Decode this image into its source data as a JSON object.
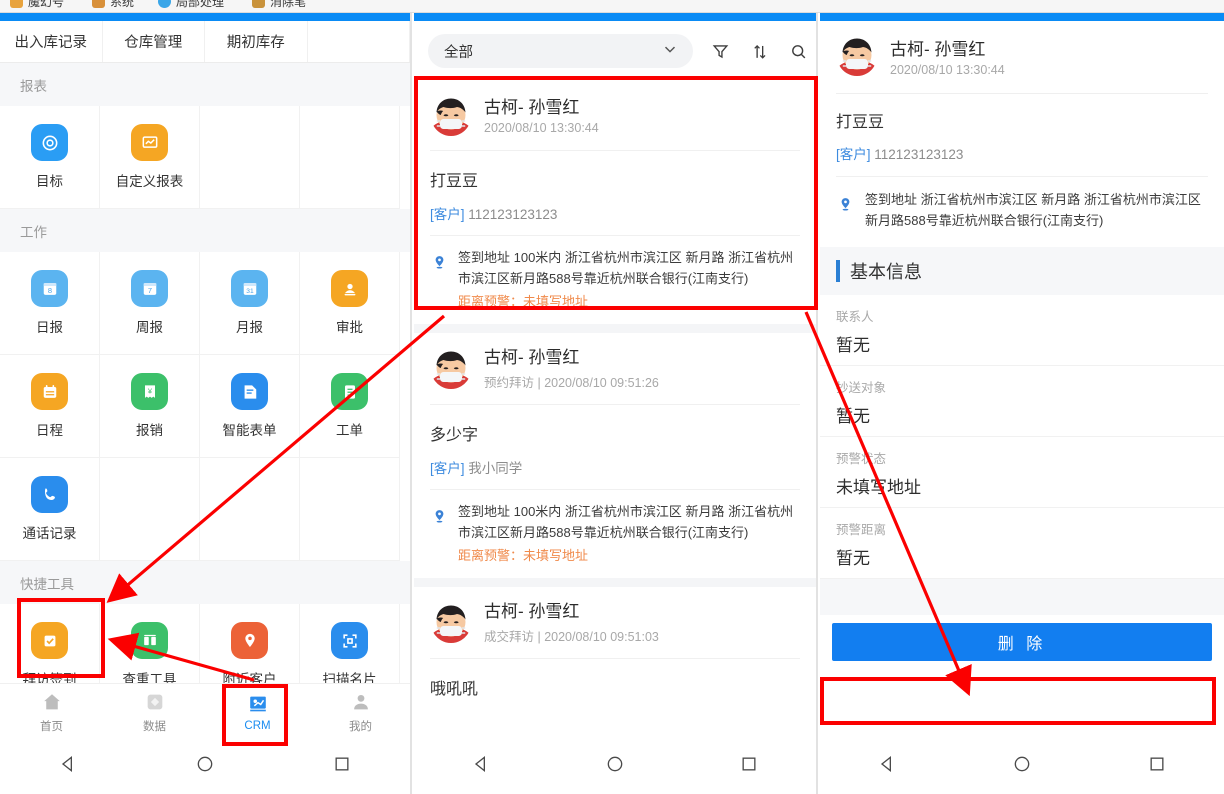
{
  "browser": {
    "bookmarks": [
      {
        "label": "魔幻号",
        "color": "#e8a33d"
      },
      {
        "label": "系统",
        "color": "#d8903a"
      },
      {
        "label": "局部处理",
        "color": "#3aa6e8"
      },
      {
        "label": "消除笔",
        "color": "#c9933c"
      }
    ]
  },
  "left_pane": {
    "tabs": [
      "出入库记录",
      "仓库管理",
      "期初库存",
      ""
    ],
    "sections": [
      {
        "title": "报表",
        "items": [
          {
            "label": "目标",
            "icon": "target-icon",
            "color": "#2a9df4"
          },
          {
            "label": "自定义报表",
            "icon": "custom-report-icon",
            "color": "#f5a623"
          },
          {
            "label": "",
            "icon": "",
            "color": ""
          },
          {
            "label": "",
            "icon": "",
            "color": ""
          }
        ]
      },
      {
        "title": "工作",
        "items": [
          {
            "label": "日报",
            "icon": "calendar-day-icon",
            "color": "#5bb4f0"
          },
          {
            "label": "周报",
            "icon": "calendar-week-icon",
            "color": "#5bb4f0"
          },
          {
            "label": "月报",
            "icon": "calendar-month-icon",
            "color": "#5bb4f0"
          },
          {
            "label": "审批",
            "icon": "approval-icon",
            "color": "#f5a623"
          },
          {
            "label": "日程",
            "icon": "schedule-icon",
            "color": "#f5a623"
          },
          {
            "label": "报销",
            "icon": "reimbursement-icon",
            "color": "#3cc06a"
          },
          {
            "label": "智能表单",
            "icon": "smart-form-icon",
            "color": "#2a8ded"
          },
          {
            "label": "工单",
            "icon": "work-order-icon",
            "color": "#3cc06a"
          },
          {
            "label": "通话记录",
            "icon": "call-log-icon",
            "color": "#2a8ded"
          },
          {
            "label": "",
            "icon": "",
            "color": ""
          },
          {
            "label": "",
            "icon": "",
            "color": ""
          },
          {
            "label": "",
            "icon": "",
            "color": ""
          }
        ]
      },
      {
        "title": "快捷工具",
        "items": [
          {
            "label": "拜访签到",
            "icon": "check-in-icon",
            "color": "#f5a623"
          },
          {
            "label": "查重工具",
            "icon": "dedup-icon",
            "color": "#3cc06a"
          },
          {
            "label": "附近客户",
            "icon": "nearby-customer-icon",
            "color": "#ec6237"
          },
          {
            "label": "扫描名片",
            "icon": "scan-card-icon",
            "color": "#2a8ded"
          }
        ]
      }
    ],
    "bottom_nav": [
      {
        "label": "首页",
        "icon": "home-icon",
        "active": false
      },
      {
        "label": "数据",
        "icon": "data-icon",
        "active": false
      },
      {
        "label": "CRM",
        "icon": "crm-icon",
        "active": true
      },
      {
        "label": "我的",
        "icon": "profile-icon",
        "active": false
      }
    ]
  },
  "mid_pane": {
    "filter_value": "全部",
    "icons": [
      "filter-icon",
      "sort-icon",
      "search-icon"
    ],
    "cards": [
      {
        "name": "古柯- 孙雪红",
        "meta": "2020/08/10 13:30:44",
        "title": "打豆豆",
        "customer_tag": "[客户]",
        "customer_name": "112123123123",
        "address": "签到地址 100米内 浙江省杭州市滨江区 新月路 浙江省杭州市滨江区新月路588号靠近杭州联合银行(江南支行)",
        "warning": "距离预警：未填写地址"
      },
      {
        "name": "古柯- 孙雪红",
        "meta": "预约拜访 | 2020/08/10 09:51:26",
        "title": "多少字",
        "customer_tag": "[客户]",
        "customer_name": "我小同学",
        "address": "签到地址 100米内 浙江省杭州市滨江区 新月路 浙江省杭州市滨江区新月路588号靠近杭州联合银行(江南支行)",
        "warning": "距离预警：未填写地址"
      },
      {
        "name": "古柯- 孙雪红",
        "meta": "成交拜访 | 2020/08/10 09:51:03",
        "title": "哦吼吼",
        "customer_tag": "",
        "customer_name": "",
        "address": "",
        "warning": ""
      }
    ]
  },
  "right_pane": {
    "name": "古柯- 孙雪红",
    "meta": "2020/08/10 13:30:44",
    "title": "打豆豆",
    "customer_tag": "[客户]",
    "customer_name": "112123123123",
    "address": "签到地址 浙江省杭州市滨江区 新月路 浙江省杭州市滨江区新月路588号靠近杭州联合银行(江南支行)",
    "section_title": "基本信息",
    "fields": [
      {
        "key": "联系人",
        "value": "暂无"
      },
      {
        "key": "抄送对象",
        "value": "暂无"
      },
      {
        "key": "预警状态",
        "value": "未填写地址"
      },
      {
        "key": "预警距离",
        "value": "暂无"
      }
    ],
    "delete_label": "删 除"
  },
  "annotation": {
    "color": "#fb0000"
  }
}
